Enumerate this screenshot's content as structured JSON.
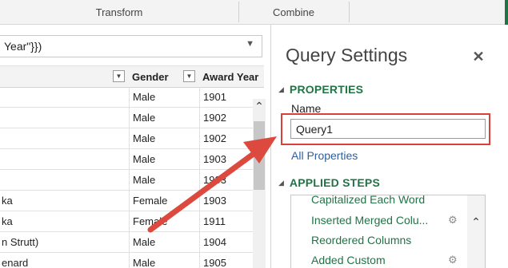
{
  "ribbon": {
    "groups": [
      "Transform",
      "Combine"
    ]
  },
  "formula_bar": {
    "text": "Year\"}})",
    "chevron": "chevron-down-icon"
  },
  "grid": {
    "columns": [
      {
        "label": "Gender"
      },
      {
        "label": "Award Year"
      }
    ],
    "rows": [
      {
        "name": "",
        "gender": "Male",
        "year": "1901"
      },
      {
        "name": "",
        "gender": "Male",
        "year": "1902"
      },
      {
        "name": "",
        "gender": "Male",
        "year": "1902"
      },
      {
        "name": "",
        "gender": "Male",
        "year": "1903"
      },
      {
        "name": "",
        "gender": "Male",
        "year": "1903"
      },
      {
        "name": "ka",
        "gender": "Female",
        "year": "1903"
      },
      {
        "name": "ka",
        "gender": "Female",
        "year": "1911"
      },
      {
        "name": "n Strutt)",
        "gender": "Male",
        "year": "1904"
      },
      {
        "name": "enard",
        "gender": "Male",
        "year": "1905"
      }
    ]
  },
  "query_settings": {
    "title": "Query Settings",
    "close_icon": "close-icon",
    "properties": {
      "section_title": "PROPERTIES",
      "name_label": "Name",
      "name_value": "Query1",
      "all_properties_link": "All Properties"
    },
    "applied_steps": {
      "section_title": "APPLIED STEPS",
      "steps": [
        {
          "label": "Capitalized Each Word",
          "has_gear": false
        },
        {
          "label": "Inserted Merged Colu...",
          "has_gear": true
        },
        {
          "label": "Reordered Columns",
          "has_gear": false
        },
        {
          "label": "Added Custom",
          "has_gear": true
        }
      ]
    }
  },
  "colors": {
    "accent_green": "#217346",
    "highlight_red": "#d9403a",
    "link_blue": "#2a5fa3"
  }
}
